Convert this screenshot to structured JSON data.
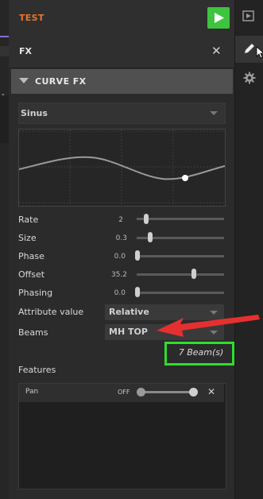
{
  "header": {
    "title": "TEST"
  },
  "fx_panel": {
    "title": "FX"
  },
  "curve_section": {
    "title": "CURVE FX"
  },
  "waveform": {
    "selected": "Sinus"
  },
  "params": [
    {
      "label": "Rate",
      "value": "2",
      "level": 0.08
    },
    {
      "label": "Size",
      "value": "0.3",
      "level": 0.12
    },
    {
      "label": "Phase",
      "value": "0.0",
      "level": 0.0
    },
    {
      "label": "Offset",
      "value": "35.2",
      "level": 0.68
    },
    {
      "label": "Phasing",
      "value": "0.0",
      "level": 0.0
    }
  ],
  "attribute_value": {
    "label": "Attribute value",
    "selected": "Relative"
  },
  "beams": {
    "label": "Beams",
    "selected": "MH TOP",
    "count": "7 Beam(s)"
  },
  "features": {
    "label": "Features",
    "items": [
      {
        "label": "Pan",
        "state": "OFF"
      }
    ]
  },
  "colors": {
    "accent_orange": "#e8742a",
    "play_green": "#3ec43e",
    "highlight_green": "#30dd30",
    "arrow_red": "#e53030"
  },
  "icons": [
    "play-icon",
    "close-icon",
    "collapse-caret-icon",
    "dropdown-arrow-icon",
    "preview-icon",
    "pencil-icon",
    "gear-icon",
    "cursor-icon",
    "red-arrow-annotation"
  ]
}
